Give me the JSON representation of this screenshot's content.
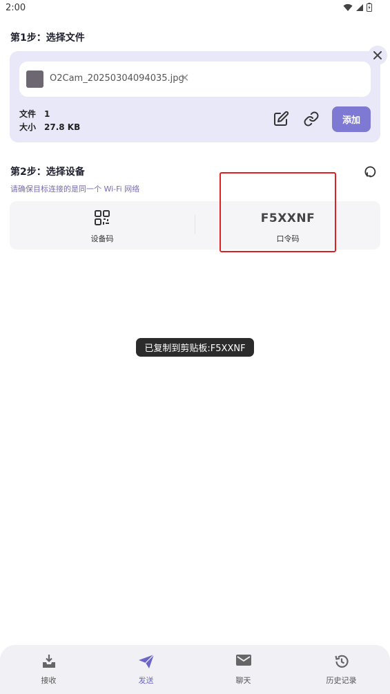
{
  "status_bar": {
    "time": "2:00"
  },
  "step1": {
    "title": "第1步：选择文件",
    "file_name": "O2Cam_20250304094035.jpg",
    "file_label": "文件",
    "file_count": "1",
    "size_label": "大小",
    "size_value": "27.8 KB",
    "add_label": "添加"
  },
  "step2": {
    "title": "第2步：选择设备",
    "hint": "请确保目标连接的是同一个 Wi-Fi 网络",
    "device_code_label": "设备码",
    "passcode_value": "F5XXNF",
    "passcode_label": "口令码"
  },
  "toast": {
    "text": "已复制到剪贴板:F5XXNF"
  },
  "nav": {
    "items": [
      {
        "label": "接收",
        "icon": "inbox-download-icon"
      },
      {
        "label": "发送",
        "icon": "send-icon"
      },
      {
        "label": "聊天",
        "icon": "mail-icon"
      },
      {
        "label": "历史记录",
        "icon": "history-icon"
      }
    ],
    "active": "发送"
  },
  "colors": {
    "accent": "#7e7ad4",
    "card_bg": "#e9e8f8",
    "highlight": "#e02020",
    "nav_active": "#6d66c9"
  }
}
